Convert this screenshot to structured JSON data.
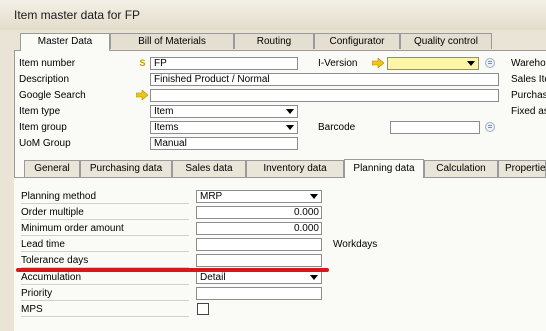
{
  "window": {
    "title": "Item master data for FP"
  },
  "main_tabs": [
    "Master Data",
    "Bill of Materials",
    "Routing",
    "Configurator",
    "Quality control"
  ],
  "header": {
    "item_number_label": "Item number",
    "item_number_series": "S",
    "item_number_value": "FP",
    "description_label": "Description",
    "description_value": "Finished Product / Normal",
    "google_search_label": "Google Search",
    "google_search_value": "",
    "item_type_label": "Item type",
    "item_type_value": "Item",
    "item_group_label": "Item group",
    "item_group_value": "Items",
    "uom_group_label": "UoM Group",
    "uom_group_value": "Manual",
    "iversion_label": "I-Version",
    "iversion_value": "",
    "barcode_label": "Barcode",
    "barcode_value": "",
    "right_labels": [
      "Wareho",
      "Sales Ite",
      "Purchas",
      "Fixed as"
    ]
  },
  "sub_tabs": [
    "General",
    "Purchasing data",
    "Sales data",
    "Inventory data",
    "Planning data",
    "Calculation",
    "Properties"
  ],
  "planning": {
    "planning_method_label": "Planning method",
    "planning_method_value": "MRP",
    "order_multiple_label": "Order multiple",
    "order_multiple_value": "0.000",
    "min_order_amount_label": "Minimum order amount",
    "min_order_amount_value": "0.000",
    "lead_time_label": "Lead time",
    "lead_time_value": "",
    "lead_time_unit": "Workdays",
    "tolerance_days_label": "Tolerance days",
    "tolerance_days_value": "",
    "accumulation_label": "Accumulation",
    "accumulation_value": "Detail",
    "priority_label": "Priority",
    "priority_value": "",
    "mps_label": "MPS",
    "mps_checked": false
  },
  "colors": {
    "annotation_underline": "#d9161c",
    "link_arrow": "#f0c419",
    "active_field": "#fff5a8"
  }
}
